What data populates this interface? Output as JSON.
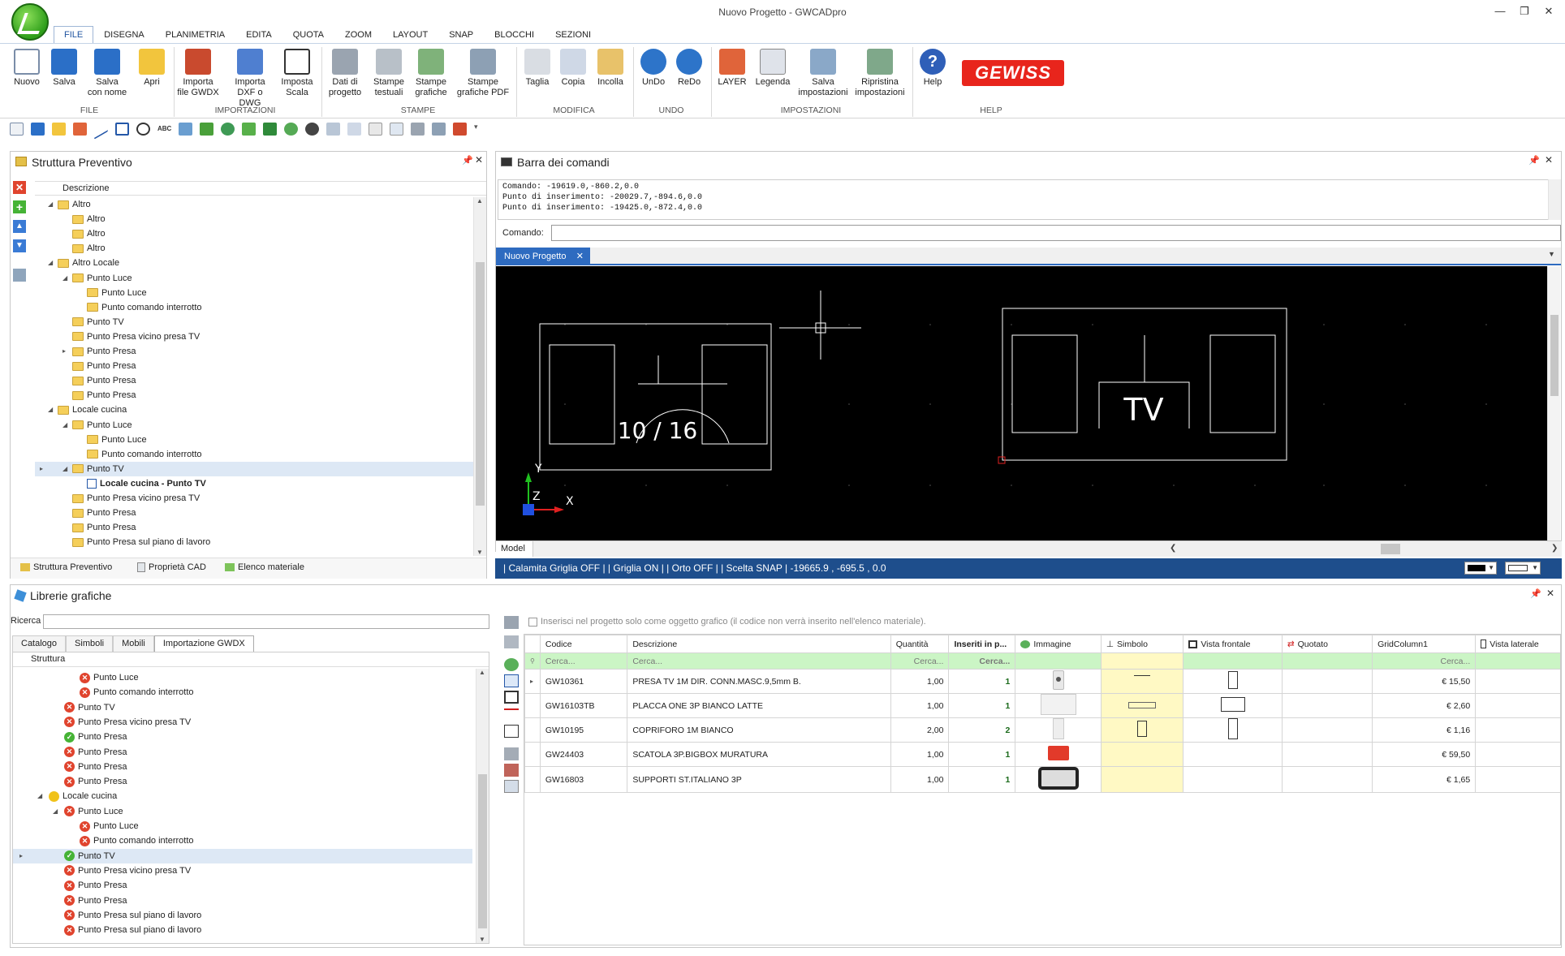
{
  "window": {
    "title": "Nuovo Progetto - GWCADpro"
  },
  "menu_tabs": [
    "FILE",
    "DISEGNA",
    "PLANIMETRIA",
    "EDITA",
    "QUOTA",
    "ZOOM",
    "LAYOUT",
    "SNAP",
    "BLOCCHI",
    "SEZIONI"
  ],
  "ribbon": {
    "buttons": [
      {
        "label": "Nuovo",
        "icon": "new-file-icon"
      },
      {
        "label": "Salva",
        "icon": "save-icon"
      },
      {
        "label": "Salva\ncon nome",
        "icon": "save-as-icon"
      },
      {
        "label": "Apri",
        "icon": "open-folder-icon"
      },
      {
        "label": "Importa\nfile GWDX",
        "icon": "import-gwdx-icon"
      },
      {
        "label": "Importa\nDXF o DWG",
        "icon": "import-dxf-icon"
      },
      {
        "label": "Imposta\nScala",
        "icon": "scale-icon"
      },
      {
        "label": "Dati di\nprogetto",
        "icon": "project-data-icon"
      },
      {
        "label": "Stampe\ntestuali",
        "icon": "print-text-icon"
      },
      {
        "label": "Stampe\ngrafiche",
        "icon": "print-graphic-icon"
      },
      {
        "label": "Stampe\ngrafiche PDF",
        "icon": "print-pdf-icon"
      },
      {
        "label": "Taglia",
        "icon": "cut-icon"
      },
      {
        "label": "Copia",
        "icon": "copy-icon"
      },
      {
        "label": "Incolla",
        "icon": "paste-icon"
      },
      {
        "label": "UnDo",
        "icon": "undo-icon"
      },
      {
        "label": "ReDo",
        "icon": "redo-icon"
      },
      {
        "label": "LAYER",
        "icon": "layer-icon"
      },
      {
        "label": "Legenda",
        "icon": "legend-icon"
      },
      {
        "label": "Salva\nimpostazioni",
        "icon": "save-settings-icon"
      },
      {
        "label": "Ripristina\nimpostazioni",
        "icon": "restore-settings-icon"
      },
      {
        "label": "Help",
        "icon": "help-icon"
      }
    ],
    "groups": [
      "FILE",
      "IMPORTAZIONI",
      "STAMPE",
      "MODIFICA",
      "UNDO",
      "IMPOSTAZIONI",
      "HELP"
    ],
    "brand": "GEWISS"
  },
  "struttura": {
    "title": "Struttura Preventivo",
    "column": "Descrizione",
    "rows": [
      {
        "label": "Altro",
        "level": 2,
        "exp": "open",
        "type": "folder"
      },
      {
        "label": "Altro",
        "level": 3,
        "type": "folder"
      },
      {
        "label": "Altro",
        "level": 3,
        "type": "folder"
      },
      {
        "label": "Altro",
        "level": 3,
        "type": "folder"
      },
      {
        "label": "Altro Locale",
        "level": 2,
        "exp": "open",
        "type": "folder"
      },
      {
        "label": "Punto Luce",
        "level": 3,
        "exp": "open",
        "type": "folder"
      },
      {
        "label": "Punto Luce",
        "level": 4,
        "type": "folder"
      },
      {
        "label": "Punto comando interrotto",
        "level": 4,
        "type": "folder"
      },
      {
        "label": "Punto TV",
        "level": 3,
        "type": "folder"
      },
      {
        "label": "Punto Presa vicino presa TV",
        "level": 3,
        "type": "folder"
      },
      {
        "label": "Punto Presa",
        "level": 3,
        "exp": "closed",
        "type": "folder"
      },
      {
        "label": "Punto Presa",
        "level": 3,
        "type": "folder"
      },
      {
        "label": "Punto Presa",
        "level": 3,
        "type": "folder"
      },
      {
        "label": "Punto Presa",
        "level": 3,
        "type": "folder"
      },
      {
        "label": "Locale cucina",
        "level": 2,
        "exp": "open",
        "type": "folder"
      },
      {
        "label": "Punto Luce",
        "level": 3,
        "exp": "open",
        "type": "folder"
      },
      {
        "label": "Punto Luce",
        "level": 4,
        "type": "folder"
      },
      {
        "label": "Punto comando interrotto",
        "level": 4,
        "type": "folder"
      },
      {
        "label": "Punto TV",
        "level": 3,
        "exp": "open",
        "type": "folder",
        "selected": true
      },
      {
        "label": "Locale cucina - Punto TV",
        "level": 4,
        "type": "item",
        "bold": true
      },
      {
        "label": "Punto Presa vicino presa TV",
        "level": 3,
        "type": "folder"
      },
      {
        "label": "Punto Presa",
        "level": 3,
        "type": "folder"
      },
      {
        "label": "Punto Presa",
        "level": 3,
        "type": "folder"
      },
      {
        "label": "Punto Presa sul piano di lavoro",
        "level": 3,
        "type": "folder"
      }
    ],
    "bottom_tabs": [
      "Struttura Preventivo",
      "Proprietà CAD",
      "Elenco materiale"
    ]
  },
  "comandi": {
    "title": "Barra dei comandi",
    "lines": [
      "Comando: -19619.0,-860.2,0.0",
      "Punto di inserimento: -20029.7,-894.6,0.0",
      "Punto di inserimento: -19425.0,-872.4,0.0"
    ],
    "prompt_label": "Comando:",
    "prompt_value": ""
  },
  "drawing": {
    "tab": "Nuovo Progetto",
    "model_tab": "Model",
    "symbol_left_text": "10 / 16",
    "symbol_right_text": "TV",
    "axis_x": "X",
    "axis_y": "Y",
    "axis_z": "Z"
  },
  "status": "| Calamita Griglia OFF | | Griglia ON | | Orto OFF | | Scelta SNAP |    -19665.9 , -695.5 , 0.0",
  "librerie": {
    "title": "Librerie grafiche",
    "search_label": "Ricerca",
    "search_value": "",
    "tabs": [
      "Catalogo",
      "Simboli",
      "Mobili",
      "Importazione GWDX"
    ],
    "column": "Struttura",
    "rows": [
      {
        "label": "Punto Luce",
        "level": 3,
        "status": "x"
      },
      {
        "label": "Punto comando interrotto",
        "level": 3,
        "status": "x"
      },
      {
        "label": "Punto TV",
        "level": 2,
        "status": "x"
      },
      {
        "label": "Punto Presa vicino presa TV",
        "level": 2,
        "status": "x"
      },
      {
        "label": "Punto Presa",
        "level": 2,
        "status": "ok"
      },
      {
        "label": "Punto Presa",
        "level": 2,
        "status": "x"
      },
      {
        "label": "Punto Presa",
        "level": 2,
        "status": "x"
      },
      {
        "label": "Punto Presa",
        "level": 2,
        "status": "x"
      },
      {
        "label": "Locale cucina",
        "level": 1,
        "status": "half",
        "exp": "open"
      },
      {
        "label": "Punto Luce",
        "level": 2,
        "status": "x",
        "exp": "open"
      },
      {
        "label": "Punto Luce",
        "level": 3,
        "status": "x"
      },
      {
        "label": "Punto comando interrotto",
        "level": 3,
        "status": "x"
      },
      {
        "label": "Punto TV",
        "level": 2,
        "status": "ok",
        "selected": true
      },
      {
        "label": "Punto Presa vicino presa TV",
        "level": 2,
        "status": "x"
      },
      {
        "label": "Punto Presa",
        "level": 2,
        "status": "x"
      },
      {
        "label": "Punto Presa",
        "level": 2,
        "status": "x"
      },
      {
        "label": "Punto Presa sul piano di lavoro",
        "level": 2,
        "status": "x"
      },
      {
        "label": "Punto Presa sul piano di lavoro",
        "level": 2,
        "status": "x"
      }
    ]
  },
  "materiale": {
    "checkbox_label": "Inserisci nel progetto solo come oggetto grafico (il codice non verrà inserito nell'elenco materiale).",
    "columns": [
      "Codice",
      "Descrizione",
      "Quantità",
      "Inseriti in p...",
      "Immagine",
      "Simbolo",
      "Vista frontale",
      "Quotato",
      "GridColumn1",
      "Vista laterale"
    ],
    "filter": [
      "Cerca...",
      "Cerca...",
      "Cerca...",
      "Cerca...",
      "",
      "",
      "",
      "",
      "Cerca..."
    ],
    "rows": [
      {
        "codice": "GW10361",
        "descrizione": "PRESA TV 1M DIR. CONN.MASC.9,5mm B.",
        "quantita": "1,00",
        "inseriti": "1",
        "prezzo": "€ 15,50"
      },
      {
        "codice": "GW16103TB",
        "descrizione": "PLACCA ONE 3P BIANCO LATTE",
        "quantita": "1,00",
        "inseriti": "1",
        "prezzo": "€ 2,60"
      },
      {
        "codice": "GW10195",
        "descrizione": "COPRIFORO 1M BIANCO",
        "quantita": "2,00",
        "inseriti": "2",
        "prezzo": "€ 1,16"
      },
      {
        "codice": "GW24403",
        "descrizione": "SCATOLA 3P.BIGBOX MURATURA",
        "quantita": "1,00",
        "inseriti": "1",
        "prezzo": "€ 59,50"
      },
      {
        "codice": "GW16803",
        "descrizione": "SUPPORTI ST.ITALIANO 3P",
        "quantita": "1,00",
        "inseriti": "1",
        "prezzo": "€ 1,65"
      }
    ]
  },
  "colors": {
    "accent": "#1e4e8c",
    "filter_row": "#cbf5c5",
    "symbol_col": "#fff9c4",
    "brand": "#e8251c"
  }
}
